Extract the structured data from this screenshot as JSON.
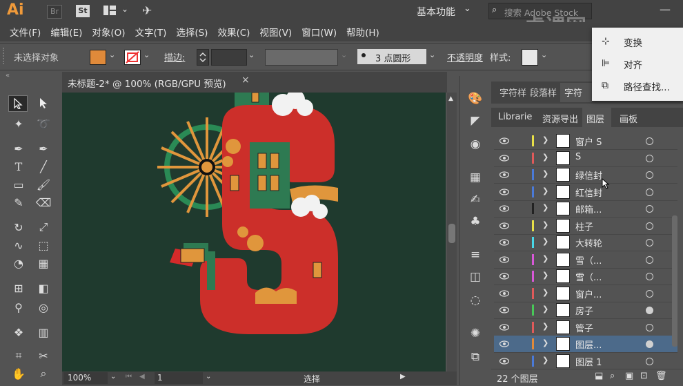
{
  "app": {
    "logo": "Ai",
    "br_label": "Br",
    "st_label": "St",
    "workspace": "基本功能",
    "search_placeholder": "搜索 Adobe Stock",
    "watermark": "虎课网"
  },
  "menu": [
    "文件(F)",
    "编辑(E)",
    "对象(O)",
    "文字(T)",
    "选择(S)",
    "效果(C)",
    "视图(V)",
    "窗口(W)",
    "帮助(H)"
  ],
  "control": {
    "selection_label": "未选择对象",
    "fill_color": "#e08a3a",
    "stroke_label": "描边:",
    "brush_label": "3 点圆形",
    "opacity_label": "不透明度",
    "style_label": "样式:"
  },
  "document": {
    "tab_title": "未标题-2* @ 100% (RGB/GPU 预览)",
    "zoom": "100%",
    "page": "1",
    "status": "选择",
    "canvas_color": "#1f3a2e"
  },
  "flyout": {
    "items": [
      "变换",
      "对齐",
      "路径查找..."
    ]
  },
  "panels": {
    "top_tabs": [
      "字符样",
      "段落样",
      "字符"
    ],
    "tabs": [
      "Librarie",
      "资源导出",
      "图层",
      "画板"
    ],
    "active_tab": "图层",
    "layer_count": "22 个图层"
  },
  "layers": [
    {
      "name": "窗户 S",
      "color": "#e8e048",
      "target": "empty"
    },
    {
      "name": "S",
      "color": "#e05a5a",
      "target": "empty"
    },
    {
      "name": "绿信封",
      "color": "#4a7ad8",
      "target": "empty"
    },
    {
      "name": "红信封",
      "color": "#4a7ad8",
      "target": "empty"
    },
    {
      "name": "邮箱...",
      "color": "#222222",
      "target": "empty"
    },
    {
      "name": "柱子",
      "color": "#e8e048",
      "target": "empty"
    },
    {
      "name": "大转轮",
      "color": "#48d8e8",
      "target": "empty"
    },
    {
      "name": "雪（...",
      "color": "#d858d8",
      "target": "empty"
    },
    {
      "name": "雪（...",
      "color": "#d858d8",
      "target": "empty"
    },
    {
      "name": "窗户...",
      "color": "#e05a5a",
      "target": "empty"
    },
    {
      "name": "房子",
      "color": "#48c858",
      "target": "filled"
    },
    {
      "name": "管子",
      "color": "#e05a5a",
      "target": "empty"
    },
    {
      "name": "图层...",
      "color": "#e08a3a",
      "target": "filled",
      "selected": true
    },
    {
      "name": "图层 1",
      "color": "#4a7ad8",
      "target": "empty"
    }
  ],
  "colors": {
    "s_red": "#cc2f2a",
    "green": "#2e7a52",
    "orange": "#e0963c",
    "snow": "#f2f2f2"
  }
}
